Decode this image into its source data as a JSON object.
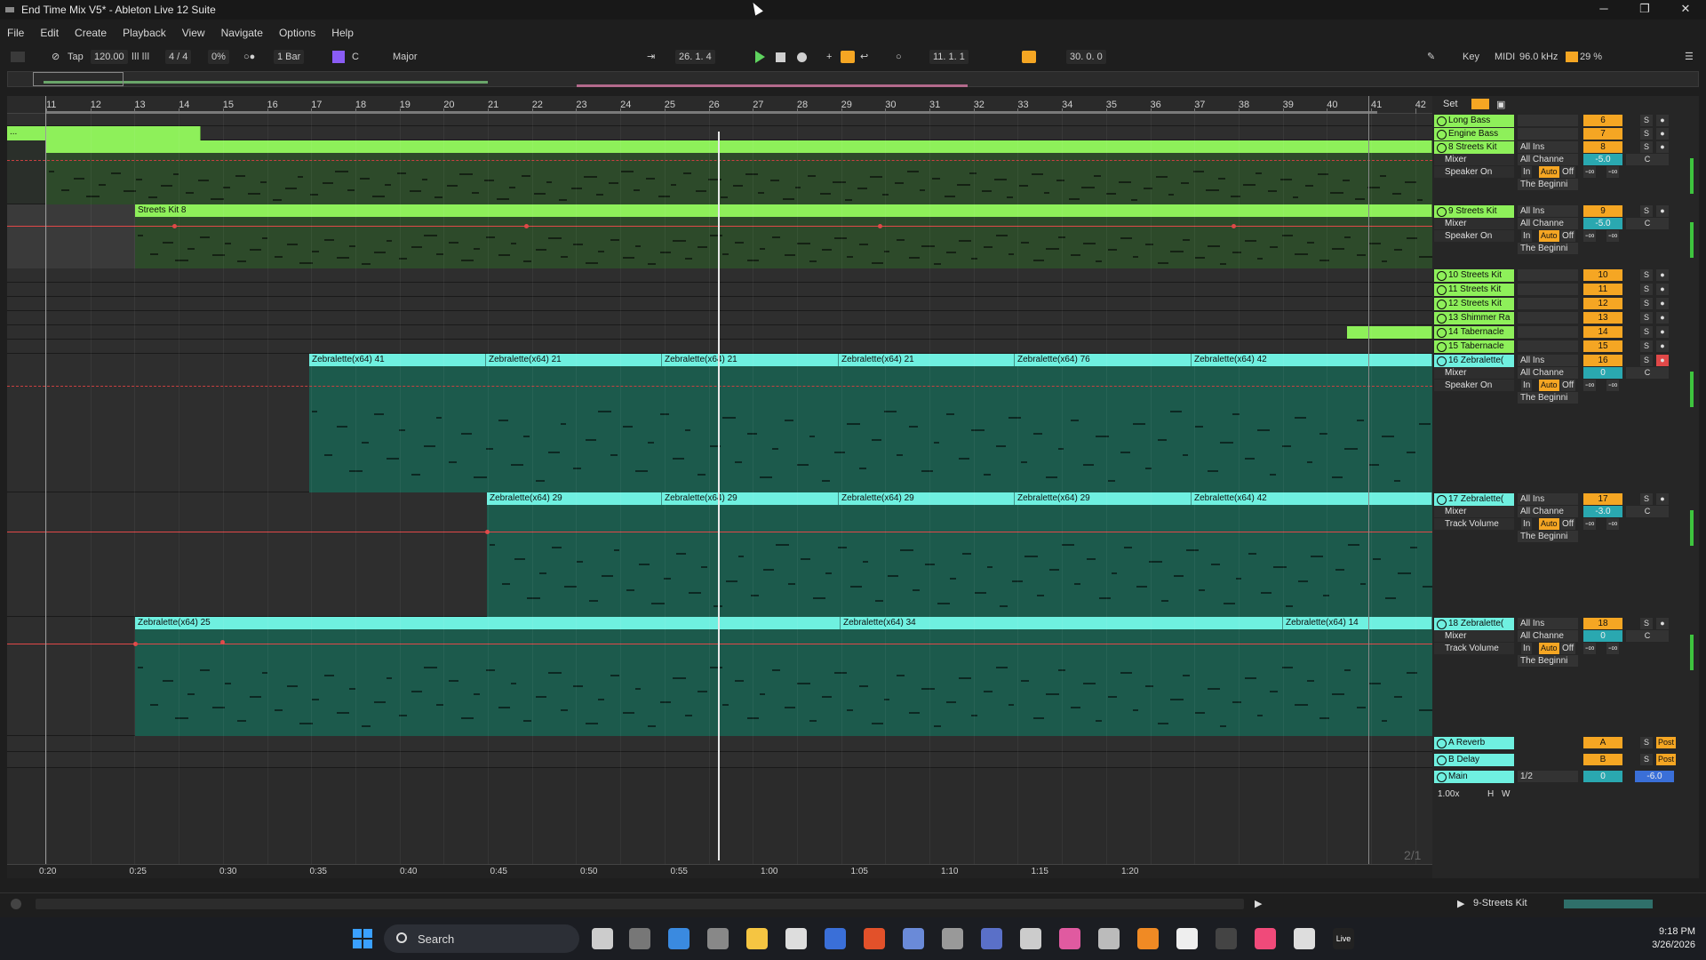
{
  "window": {
    "title": "End Time Mix V5* - Ableton Live 12 Suite",
    "min": "─",
    "max": "❐",
    "close": "✕"
  },
  "menu": [
    "File",
    "Edit",
    "Create",
    "Playback",
    "View",
    "Navigate",
    "Options",
    "Help"
  ],
  "control": {
    "tap": "Tap",
    "tempo": "120.00",
    "signature": "4 / 4",
    "swing": "0%",
    "quantize": "1 Bar",
    "key": "C",
    "scale": "Major",
    "position": "26.   1.   4",
    "loop_start": "11.   1.   1",
    "loop_length": "30.   0.   0",
    "key_btn": "Key",
    "midi_btn": "MIDI",
    "sample_rate": "96.0 kHz",
    "cpu": "29 %"
  },
  "ruler": {
    "bars": [
      "11",
      "12",
      "13",
      "14",
      "15",
      "16",
      "17",
      "18",
      "19",
      "20",
      "21",
      "22",
      "23",
      "24",
      "25",
      "26",
      "27",
      "28",
      "29",
      "30",
      "31",
      "32",
      "33",
      "34",
      "35",
      "36",
      "37",
      "38",
      "39",
      "40",
      "41",
      "42"
    ],
    "set_label": "Set"
  },
  "timeline": [
    "0:20",
    "0:25",
    "0:30",
    "0:35",
    "0:40",
    "0:45",
    "0:50",
    "0:55",
    "1:00",
    "1:05",
    "1:10",
    "1:15",
    "1:20"
  ],
  "zoom_indicator": "2/1",
  "clips": {
    "t2_clip": "...",
    "t9": "Streets Kit 8",
    "t16": [
      "Zebralette(x64) 41",
      "Zebralette(x64) 21",
      "Zebralette(x64) 21",
      "Zebralette(x64) 21",
      "Zebralette(x64) 76",
      "Zebralette(x64) 42"
    ],
    "t17": [
      "Zebralette(x64) 29",
      "Zebralette(x64) 29",
      "Zebralette(x64) 29",
      "Zebralette(x64) 29",
      "Zebralette(x64) 42"
    ],
    "t18": [
      "Zebralette(x64) 25",
      "Zebralette(x64) 34",
      "Zebralette(x64) 14"
    ]
  },
  "tracks": [
    {
      "name": "Long Bass",
      "num": "6"
    },
    {
      "name": "Engine Bass",
      "num": "7"
    },
    {
      "name": "8 Streets Kit",
      "num": "8",
      "input": "All Ins",
      "channel": "All Channe",
      "device": "Mixer",
      "param": "Speaker On",
      "vol": "-5.0",
      "pan": "C",
      "out": "The Beginni"
    },
    {
      "name": "9 Streets Kit",
      "num": "9",
      "input": "All Ins",
      "channel": "All Channe",
      "device": "Mixer",
      "param": "Speaker On",
      "vol": "-5.0",
      "pan": "C",
      "out": "The Beginni"
    },
    {
      "name": "10 Streets Kit",
      "num": "10"
    },
    {
      "name": "11 Streets Kit",
      "num": "11"
    },
    {
      "name": "12 Streets Kit",
      "num": "12"
    },
    {
      "name": "13 Shimmer Ra",
      "num": "13"
    },
    {
      "name": "14 Tabernacle",
      "num": "14"
    },
    {
      "name": "15 Tabernacle",
      "num": "15"
    },
    {
      "name": "16 Zebralette(",
      "num": "16",
      "input": "All Ins",
      "channel": "All Channe",
      "device": "Mixer",
      "param": "Speaker On",
      "vol": "0",
      "pan": "C",
      "out": "The Beginni"
    },
    {
      "name": "17 Zebralette(",
      "num": "17",
      "input": "All Ins",
      "channel": "All Channe",
      "device": "Mixer",
      "param": "Track Volume",
      "vol": "-3.0",
      "pan": "C",
      "out": "The Beginni"
    },
    {
      "name": "18 Zebralette(",
      "num": "18",
      "input": "All Ins",
      "channel": "All Channe",
      "device": "Mixer",
      "param": "Track Volume",
      "vol": "0",
      "pan": "C",
      "out": "The Beginni"
    }
  ],
  "returns": [
    {
      "name": "A Reverb",
      "letter": "A",
      "post": "Post"
    },
    {
      "name": "B Delay",
      "letter": "B",
      "post": "Post"
    },
    {
      "name": "Main",
      "routing": "1/2",
      "vol": "0",
      "pan": "-6.0"
    }
  ],
  "common": {
    "in": "In",
    "auto": "Auto",
    "off": "Off",
    "inf": "-∞",
    "solo": "S",
    "zoom": "1.00x",
    "h": "H",
    "w": "W"
  },
  "status": {
    "selected": "9-Streets Kit"
  },
  "taskbar": {
    "search": "Search",
    "time": "9:18 PM",
    "date": "3/26/2026",
    "live": "Live"
  }
}
